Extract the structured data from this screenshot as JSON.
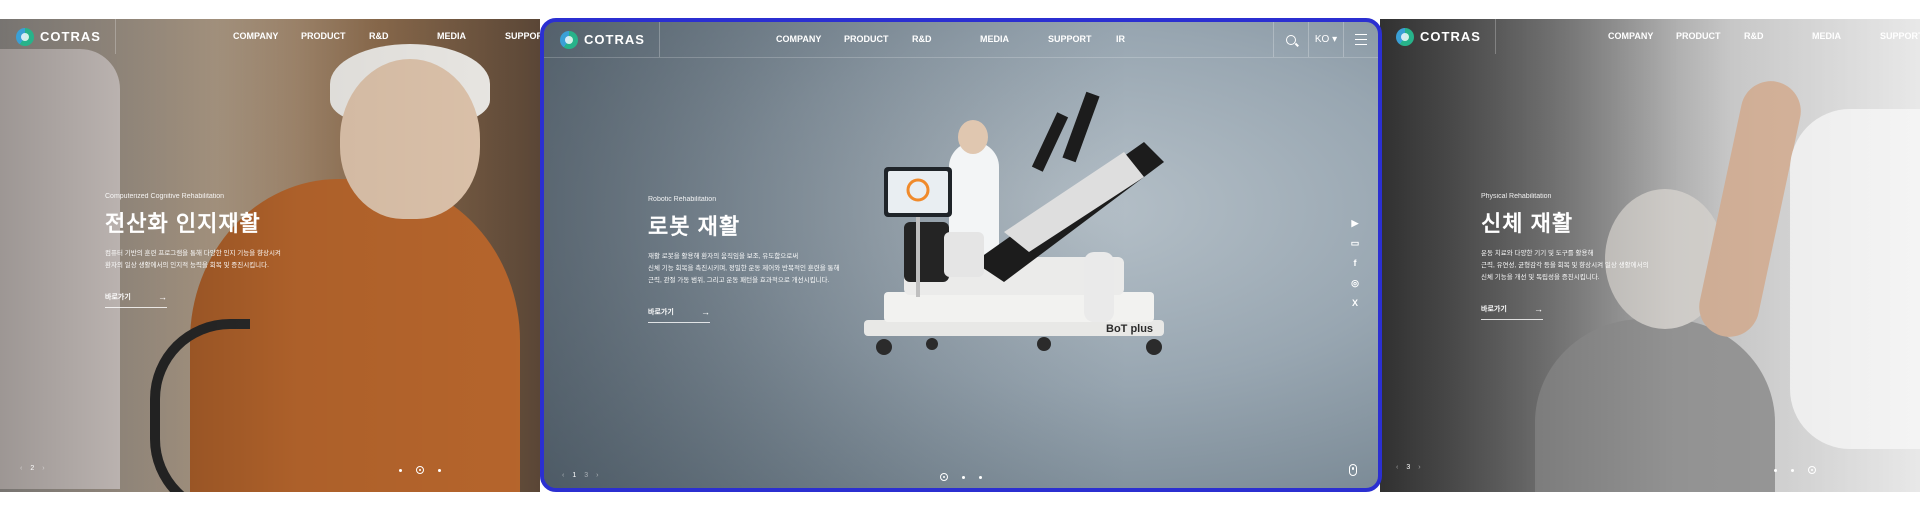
{
  "brand": {
    "name": "COTRAS"
  },
  "nav": {
    "items": [
      "COMPANY",
      "PRODUCT",
      "R&D",
      "MEDIA",
      "SUPPORT",
      "IR"
    ]
  },
  "header": {
    "lang": "KO ▾"
  },
  "left_slide": {
    "eyebrow": "Computerized Cognitive Rehabilitation",
    "title": "전산화 인지재활",
    "description": "컴퓨터 기반의 훈련 프로그램을 통해 다양한 인지 기능을 향상시켜\n환자의 일상 생활에서의 인지적 능력을 회복 및 증진시킵니다.",
    "more_label": "바로가기",
    "page": "2"
  },
  "main_slide": {
    "eyebrow": "Robotic Rehabilitation",
    "title": "로봇 재활",
    "description": "재활 로봇을 활용해 환자의 움직임을 보조, 유도함으로써\n신체 기능 회복을 촉진시키며, 정밀한 운동 제어와 반복적인 훈련을 통해\n근력, 관절 가동 범위, 그리고 운동 패턴을 효과적으로 개선시킵니다.",
    "more_label": "바로가기",
    "page": "1",
    "page_alt": "3",
    "product_label": "BoT plus"
  },
  "right_slide": {
    "eyebrow": "Physical Rehabilitation",
    "title": "신체 재활",
    "description": "운동 치료와 다양한 기기 및 도구를 활용해\n근력, 유연성, 균형감각 등을 회복 및 향상시켜 일상 생활에서의\n신체 기능을 개선 및 독립성을 증진시킵니다.",
    "more_label": "바로가기",
    "page": "3"
  },
  "social": [
    "youtube-icon",
    "blog-icon",
    "facebook-icon",
    "instagram-icon",
    "x-icon"
  ],
  "colors": {
    "accent_border": "#2b2fd1",
    "logo_green": "#27b38a",
    "logo_blue": "#3aa0d6"
  }
}
